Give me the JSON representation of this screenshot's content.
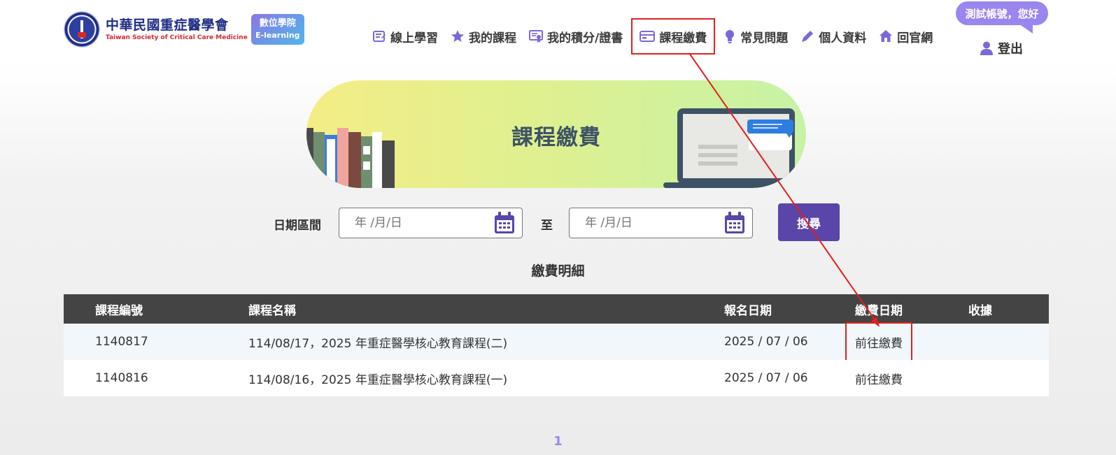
{
  "header": {
    "org_name_cn": "中華民國重症醫學會",
    "org_name_en": "Taiwan Society of Critical Care Medicine",
    "badge_line1": "數位學院",
    "badge_line2": "E-learning",
    "greeting": "測試帳號，您好",
    "logout": "登出"
  },
  "nav": {
    "items": [
      {
        "label": "線上學習",
        "icon": "course-list-icon"
      },
      {
        "label": "我的課程",
        "icon": "star-icon"
      },
      {
        "label": "我的積分/證書",
        "icon": "certificate-icon"
      },
      {
        "label": "課程繳費",
        "icon": "credit-card-icon"
      },
      {
        "label": "常見問題",
        "icon": "lightbulb-icon"
      },
      {
        "label": "個人資料",
        "icon": "pencil-icon"
      },
      {
        "label": "回官網",
        "icon": "home-icon"
      }
    ]
  },
  "banner": {
    "title": "課程繳費"
  },
  "filter": {
    "label": "日期區間",
    "start_placeholder": "年 /月/日",
    "to_label": "至",
    "end_placeholder": "年 /月/日",
    "search_label": "搜尋"
  },
  "section_title": "繳費明細",
  "table": {
    "headers": [
      "課程編號",
      "課程名稱",
      "報名日期",
      "繳費日期",
      "收據"
    ],
    "rows": [
      {
        "id": "1140817",
        "name": "114/08/17，2025 年重症醫學核心教育課程(二)",
        "reg_date": "2025 / 07 / 06",
        "pay": "前往繳費",
        "receipt": ""
      },
      {
        "id": "1140816",
        "name": "114/08/16，2025 年重症醫學核心教育課程(一)",
        "reg_date": "2025 / 07 / 06",
        "pay": "前往繳費",
        "receipt": ""
      }
    ]
  },
  "pagination": {
    "current": "1"
  },
  "colors": {
    "brand_purple": "#5a45a8",
    "greeting_purple": "#9b85ee",
    "annotation_red": "#e02020",
    "table_header": "#444444"
  }
}
